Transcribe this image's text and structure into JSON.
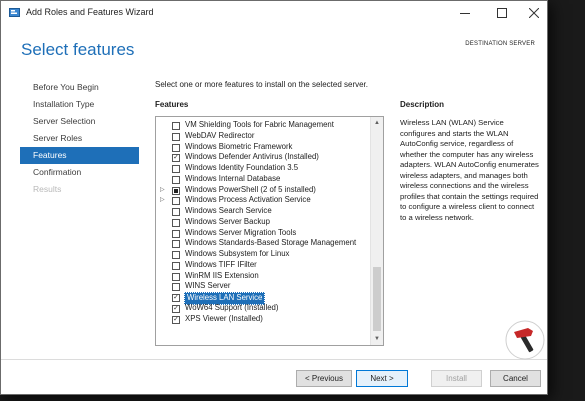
{
  "window": {
    "title": "Add Roles and Features Wizard"
  },
  "header": {
    "page_title": "Select features",
    "destination_label": "DESTINATION SERVER"
  },
  "sidebar": {
    "items": [
      {
        "label": "Before You Begin",
        "state": "normal"
      },
      {
        "label": "Installation Type",
        "state": "normal"
      },
      {
        "label": "Server Selection",
        "state": "normal"
      },
      {
        "label": "Server Roles",
        "state": "normal"
      },
      {
        "label": "Features",
        "state": "active"
      },
      {
        "label": "Confirmation",
        "state": "normal"
      },
      {
        "label": "Results",
        "state": "disabled"
      }
    ]
  },
  "main": {
    "instruction": "Select one or more features to install on the selected server.",
    "features_heading": "Features",
    "features": [
      {
        "label": "VM Shielding Tools for Fabric Management",
        "checked": false,
        "expander": false
      },
      {
        "label": "WebDAV Redirector",
        "checked": false,
        "expander": false
      },
      {
        "label": "Windows Biometric Framework",
        "checked": false,
        "expander": false
      },
      {
        "label": "Windows Defender Antivirus (Installed)",
        "checked": true,
        "expander": false
      },
      {
        "label": "Windows Identity Foundation 3.5",
        "checked": false,
        "expander": false
      },
      {
        "label": "Windows Internal Database",
        "checked": false,
        "expander": false
      },
      {
        "label": "Windows PowerShell (2 of 5 installed)",
        "checked": "partial",
        "expander": true
      },
      {
        "label": "Windows Process Activation Service",
        "checked": false,
        "expander": true
      },
      {
        "label": "Windows Search Service",
        "checked": false,
        "expander": false
      },
      {
        "label": "Windows Server Backup",
        "checked": false,
        "expander": false
      },
      {
        "label": "Windows Server Migration Tools",
        "checked": false,
        "expander": false
      },
      {
        "label": "Windows Standards-Based Storage Management",
        "checked": false,
        "expander": false
      },
      {
        "label": "Windows Subsystem for Linux",
        "checked": false,
        "expander": false
      },
      {
        "label": "Windows TIFF IFilter",
        "checked": false,
        "expander": false
      },
      {
        "label": "WinRM IIS Extension",
        "checked": false,
        "expander": false
      },
      {
        "label": "WINS Server",
        "checked": false,
        "expander": false
      },
      {
        "label": "Wireless LAN Service",
        "checked": true,
        "expander": false,
        "selected": true
      },
      {
        "label": "WoW64 Support (Installed)",
        "checked": true,
        "expander": false
      },
      {
        "label": "XPS Viewer (Installed)",
        "checked": true,
        "expander": false
      }
    ],
    "description_heading": "Description",
    "description_text": "Wireless LAN (WLAN) Service configures and starts the WLAN AutoConfig service, regardless of whether the computer has any wireless adapters. WLAN AutoConfig enumerates wireless adapters, and manages both wireless connections and the wireless profiles that contain the settings required to configure a wireless client to connect to a wireless network."
  },
  "footer": {
    "previous_label": "< Previous",
    "next_label": "Next >",
    "install_label": "Install",
    "cancel_label": "Cancel"
  },
  "colors": {
    "accent": "#1e6fb8",
    "selection": "#1e6fb8"
  }
}
